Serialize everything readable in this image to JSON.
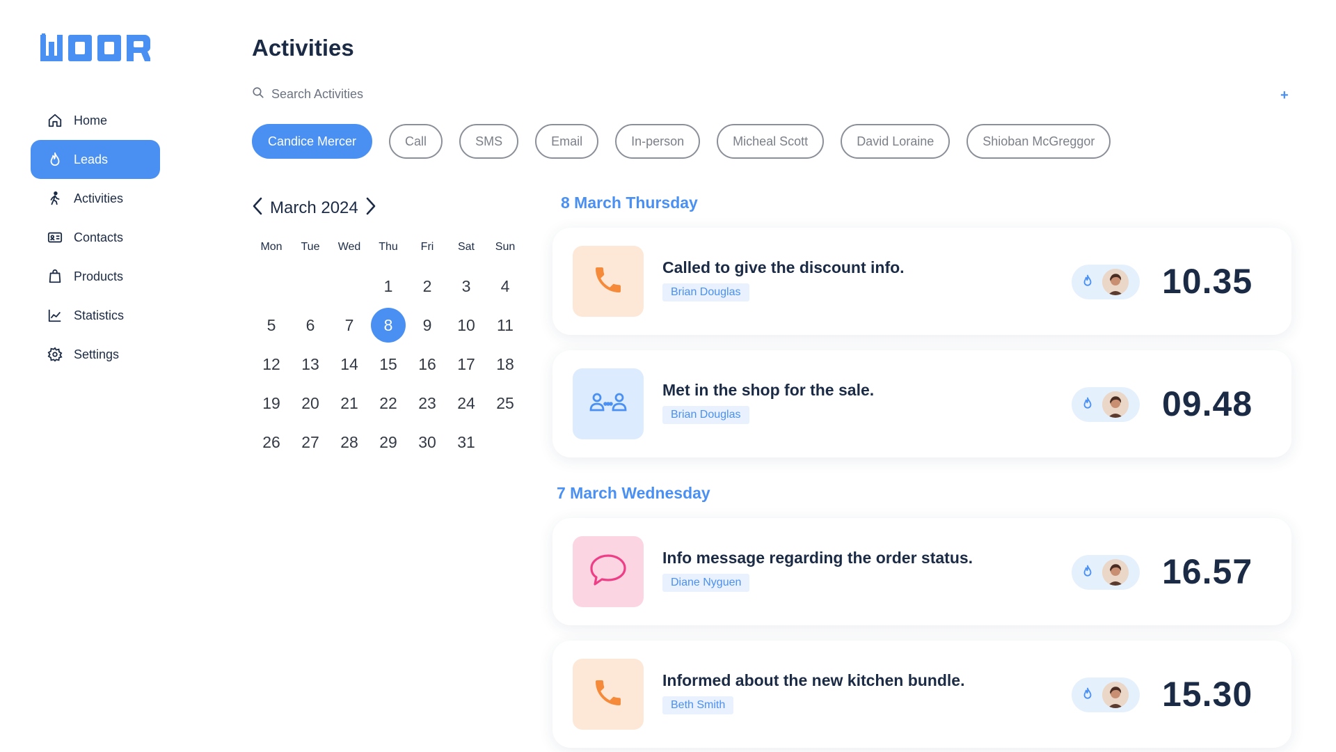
{
  "brand": {
    "name": "WOOR",
    "accent": "#4a90f2"
  },
  "sidebar": {
    "items": [
      {
        "label": "Home",
        "icon": "home-icon"
      },
      {
        "label": "Leads",
        "icon": "flame-icon",
        "active": true
      },
      {
        "label": "Activities",
        "icon": "walking-icon"
      },
      {
        "label": "Contacts",
        "icon": "id-card-icon"
      },
      {
        "label": "Products",
        "icon": "bag-icon"
      },
      {
        "label": "Statistics",
        "icon": "chart-icon"
      },
      {
        "label": "Settings",
        "icon": "gear-icon"
      }
    ]
  },
  "header": {
    "title": "Activities",
    "search_placeholder": "Search Activities",
    "add_label": "+"
  },
  "filters": [
    {
      "label": "Candice Mercer",
      "active": true
    },
    {
      "label": "Call"
    },
    {
      "label": "SMS"
    },
    {
      "label": "Email"
    },
    {
      "label": "In-person"
    },
    {
      "label": "Micheal Scott"
    },
    {
      "label": "David Loraine"
    },
    {
      "label": "Shioban McGreggor"
    }
  ],
  "calendar": {
    "month_label": "March 2024",
    "weekdays": [
      "Mon",
      "Tue",
      "Wed",
      "Thu",
      "Fri",
      "Sat",
      "Sun"
    ],
    "days": [
      "",
      "",
      "",
      "1",
      "2",
      "3",
      "4",
      "5",
      "6",
      "7",
      "8",
      "9",
      "10",
      "11",
      "12",
      "13",
      "14",
      "15",
      "16",
      "17",
      "18",
      "19",
      "20",
      "21",
      "22",
      "23",
      "24",
      "25",
      "26",
      "27",
      "28",
      "29",
      "30",
      "31",
      ""
    ],
    "selected": "8"
  },
  "feed": {
    "groups": [
      {
        "title": "8 March Thursday",
        "items": [
          {
            "title": "Called to give the discount info.",
            "person": "Brian Douglas",
            "time": "10.35",
            "type": "call"
          },
          {
            "title": "Met in the shop for the sale.",
            "person": "Brian Douglas",
            "time": "09.48",
            "type": "in-person"
          }
        ]
      },
      {
        "title": "7 March Wednesday",
        "items": [
          {
            "title": "Info message regarding the order status.",
            "person": "Diane Nyguen",
            "time": "16.57",
            "type": "sms"
          },
          {
            "title": "Informed about the new kitchen bundle.",
            "person": "Beth Smith",
            "time": "15.30",
            "type": "call"
          }
        ]
      }
    ]
  },
  "colors": {
    "call_tile": "#fde8d7",
    "call_icon": "#f58a3a",
    "meet_tile": "#dcebfd",
    "meet_icon": "#4a90f2",
    "sms_tile": "#fcd5e3",
    "sms_icon": "#ee3f86"
  }
}
